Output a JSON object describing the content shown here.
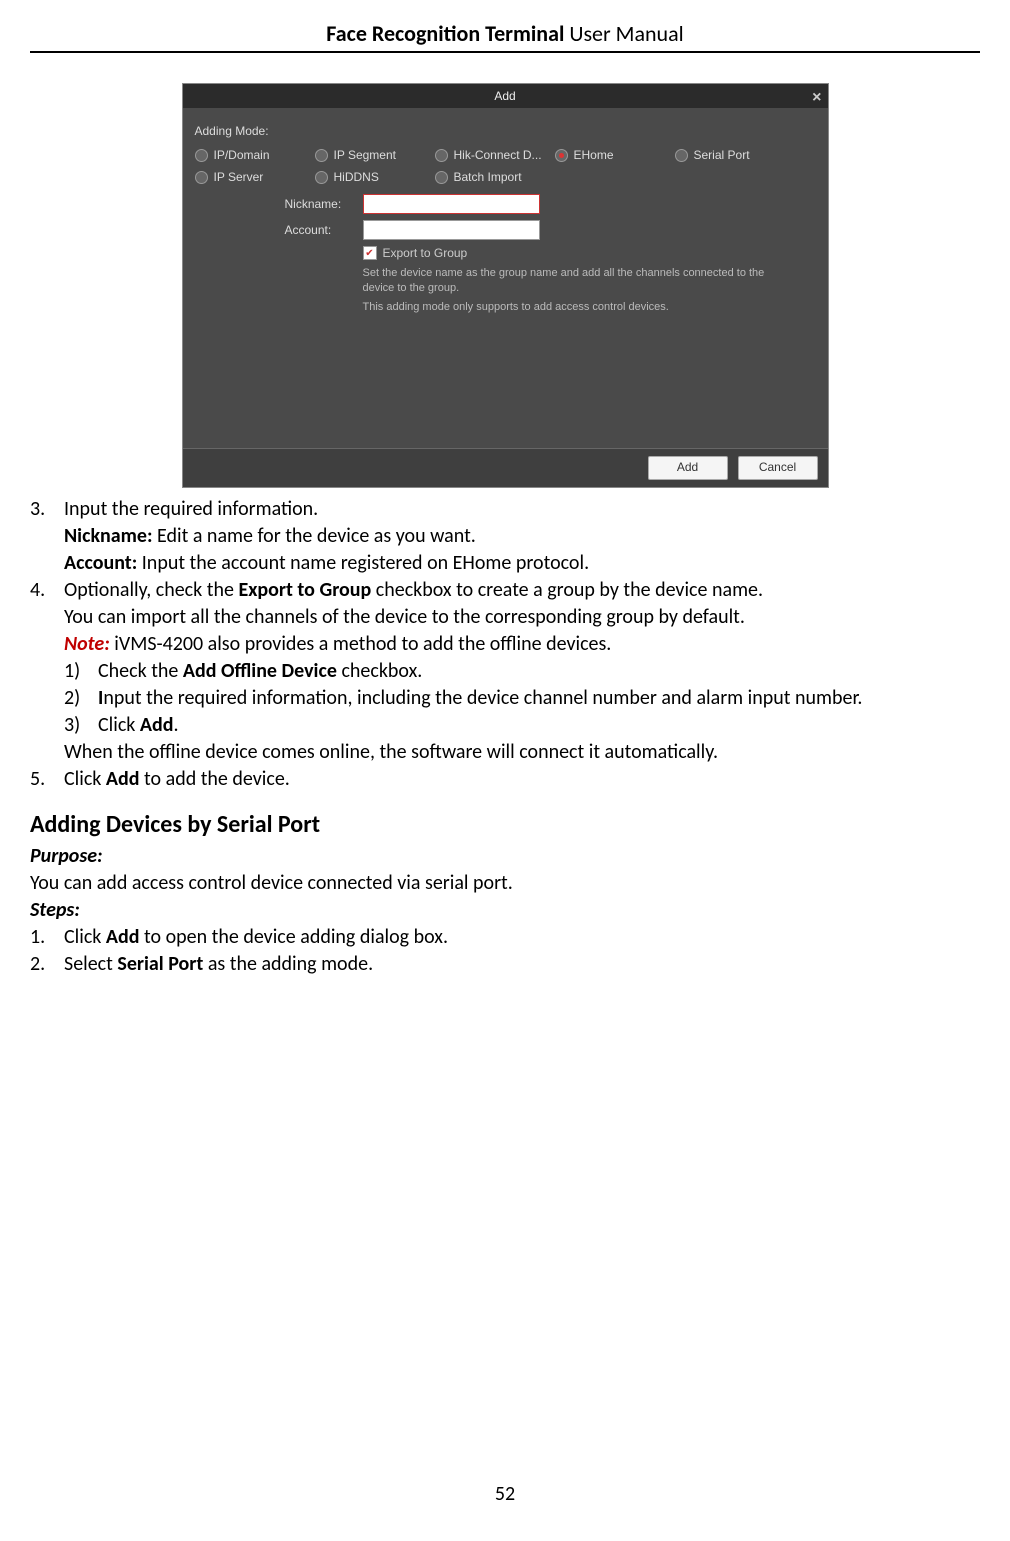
{
  "header": {
    "bold": "Face Recognition Terminal",
    "thin": "  User Manual"
  },
  "page_number": "52",
  "dialog": {
    "title": "Add",
    "close": "×",
    "adding_mode_label": "Adding Mode:",
    "radios": [
      "IP/Domain",
      "IP Segment",
      "Hik-Connect D...",
      "EHome",
      "Serial Port",
      "IP Server",
      "HiDDNS",
      "Batch Import"
    ],
    "radio_selected": "EHome",
    "nickname_label": "Nickname:",
    "account_label": "Account:",
    "export_checked": true,
    "export_label": "Export to Group",
    "hint1": "Set the device name as the group name and add all the channels connected to the device to the group.",
    "hint2": "This adding mode only supports to add access control devices.",
    "btn_add": "Add",
    "btn_cancel": "Cancel"
  },
  "doc": {
    "step3_num": "3.",
    "step3_text": "Input the required information.",
    "step3_nick_b": "Nickname:",
    "step3_nick": " Edit a name for the device as you want.",
    "step3_acc_b": "Account:",
    "step3_acc": " Input the account name registered on EHome protocol.",
    "step4_num": "4.",
    "step4_a": "Optionally, check the ",
    "step4_b": "Export to Group",
    "step4_c": " checkbox to create a group by the device name.",
    "step4_line2": "You can import all the channels of the device to the corresponding group by default.",
    "note_b": "Note:",
    "note_t": " iVMS-4200 also provides a method to add the offline devices.",
    "s1_num": "1)",
    "s1_a": "Check the ",
    "s1_b": "Add Offline Device",
    "s1_c": " checkbox.",
    "s2_num": "2)",
    "s2_a": "I",
    "s2_b": "nput the required information, including the device channel number and alarm input number.",
    "s3_num": "3)",
    "s3_a": "Click ",
    "s3_b": "Add",
    "s3_c": ".",
    "after_sub": "When the offline device comes online, the software will connect it automatically.",
    "step5_num": "5.",
    "step5_a": "Click ",
    "step5_b": "Add",
    "step5_c": " to add the device.",
    "h3": "Adding Devices by Serial Port",
    "purpose_b": "Purpose:",
    "purpose_t": "You can add access control device connected via serial port.",
    "steps_b": "Steps:",
    "sp1_num": "1.",
    "sp1_a": "Click ",
    "sp1_b": "Add",
    "sp1_c": " to open the device adding dialog box.",
    "sp2_num": "2.",
    "sp2_a": "Select ",
    "sp2_b": "Serial Port",
    "sp2_c": " as the adding mode."
  }
}
